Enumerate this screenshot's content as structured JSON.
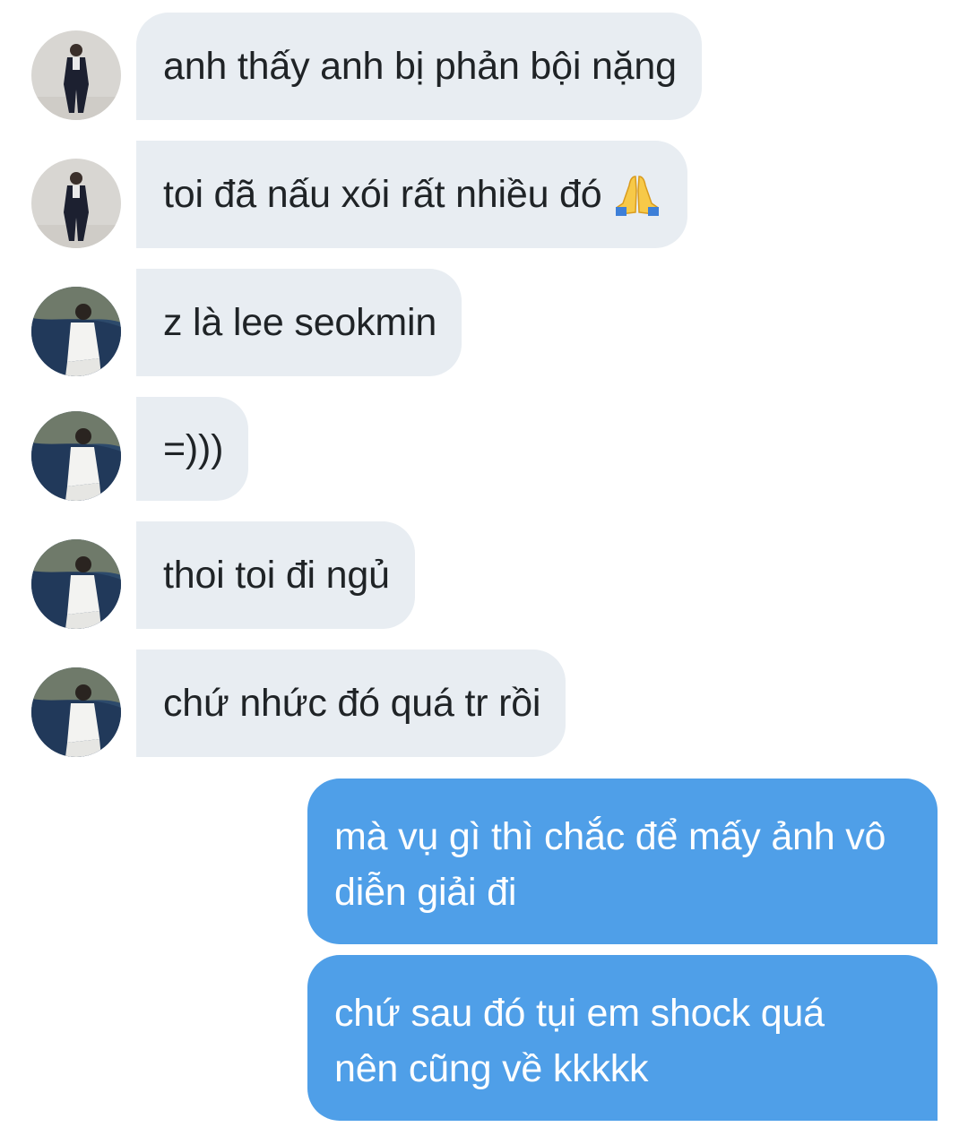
{
  "thread": {
    "messages": [
      {
        "sender": "contact-a",
        "direction": "incoming",
        "text": "anh thấy anh bị phản bội nặng"
      },
      {
        "sender": "contact-a",
        "direction": "incoming",
        "text": "toi đã nấu xói rất nhiều đó",
        "emoji": "folded-hands-emoji"
      },
      {
        "sender": "contact-b",
        "direction": "incoming",
        "text": "z là lee seokmin"
      },
      {
        "sender": "contact-b",
        "direction": "incoming",
        "text": "=)))"
      },
      {
        "sender": "contact-b",
        "direction": "incoming",
        "text": "thoi toi đi ngủ"
      },
      {
        "sender": "contact-b",
        "direction": "incoming",
        "text": "chứ nhức đó quá tr rồi"
      },
      {
        "sender": "me",
        "direction": "outgoing",
        "lines": [
          "mà vụ gì thì chắc để mấy ảnh vô",
          "diễn giải đi"
        ]
      },
      {
        "sender": "me",
        "direction": "outgoing",
        "lines": [
          "chứ sau đó tụi em shock quá",
          "nên cũng về kkkkk"
        ]
      }
    ]
  },
  "colors": {
    "incoming_bubble": "#e8edf2",
    "outgoing_bubble": "#4f9fe8",
    "incoming_text": "#1f2326",
    "outgoing_text": "#ffffff"
  }
}
